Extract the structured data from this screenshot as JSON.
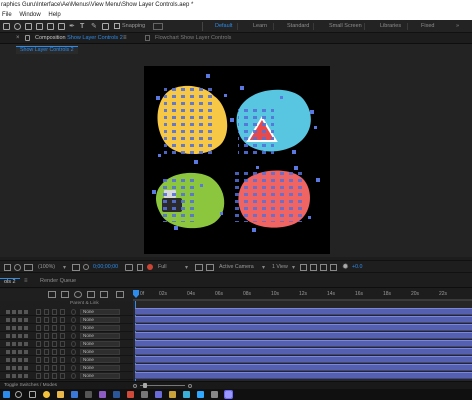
{
  "window": {
    "title": "raphics Guru\\Interface\\Ae\\Menus\\View Menu\\Show Layer Controls.aep *"
  },
  "menubar": {
    "items": [
      "File",
      "Window",
      "Help"
    ]
  },
  "toolbar": {
    "snapping_label": "Snapping",
    "workspaces": [
      "Default",
      "Learn",
      "Standard",
      "Small Screen",
      "Libraries",
      "Fixed"
    ],
    "active_workspace": "Default",
    "overflow": "»"
  },
  "composition_panel": {
    "tab_prefix": "Composition",
    "tab_comp_name": "Show Layer Controls 2",
    "tab_menu": "≡",
    "flowchart_label": "Flowchart",
    "flowchart_comp": "Show Layer Controls",
    "sub_tab": "Show Layer Controls 2"
  },
  "viewer_controls": {
    "magnification": "(100%)",
    "timecode": "0;00;00;00",
    "resolution": "Full",
    "camera": "Active Camera",
    "views": "1 View",
    "exposure": "+0.0"
  },
  "timeline": {
    "tab_label": "ols 2",
    "render_queue_label": "Render Queue",
    "header_parent_link": "Parent & Link",
    "ruler_labels": [
      "0f",
      "02s",
      "04s",
      "06s",
      "08s",
      "10s",
      "12s",
      "14s",
      "16s",
      "18s",
      "20s",
      "22s"
    ],
    "layers": [
      {
        "parent": "None"
      },
      {
        "parent": "None"
      },
      {
        "parent": "None"
      },
      {
        "parent": "None"
      },
      {
        "parent": "None"
      },
      {
        "parent": "None"
      },
      {
        "parent": "None"
      },
      {
        "parent": "None"
      },
      {
        "parent": "None"
      }
    ],
    "status_toggle_label": "Toggle Switches / Modes"
  },
  "colors": {
    "accent_blue": "#2d8ceb",
    "track_blue": "#5660b0",
    "blob_yellow": "#f7c845",
    "blob_cyan": "#58c6e0",
    "blob_green": "#8cc63e",
    "blob_red": "#f06464"
  },
  "taskbar": {
    "icons": [
      "windows-start",
      "search",
      "task-view",
      "chrome",
      "explorer",
      "mail",
      "app",
      "app",
      "word",
      "app",
      "app",
      "app",
      "app",
      "app",
      "photoshop",
      "app",
      "after-effects"
    ]
  }
}
